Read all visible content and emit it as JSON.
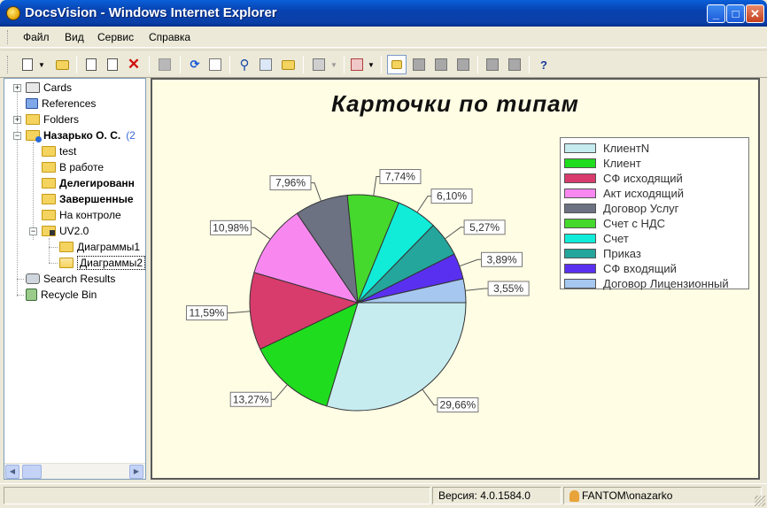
{
  "window": {
    "title": "DocsVision - Windows Internet Explorer",
    "min_label": "_",
    "max_label": "□",
    "close_label": "✕"
  },
  "menu": [
    "Файл",
    "Вид",
    "Сервис",
    "Справка"
  ],
  "tree": {
    "items": [
      {
        "label": "Cards",
        "icon": "cards-icon"
      },
      {
        "label": "References",
        "icon": "book-icon"
      },
      {
        "label": "Folders",
        "icon": "folder-icon"
      },
      {
        "label": "Назарько О. С.",
        "badge": "(2"
      },
      {
        "label": "test"
      },
      {
        "label": "В работе"
      },
      {
        "label": "Делегированн"
      },
      {
        "label": "Завершенные"
      },
      {
        "label": "На контроле"
      },
      {
        "label": "UV2.0"
      },
      {
        "label": "Диаграммы1"
      },
      {
        "label": "Диаграммы2"
      },
      {
        "label": "Search Results"
      },
      {
        "label": "Recycle Bin"
      }
    ]
  },
  "status": {
    "version": "Версия: 4.0.1584.0",
    "user": "FANTOM\\onazarko"
  },
  "chart_data": {
    "type": "pie",
    "title": "Карточки по типам",
    "legend_position": "top-right",
    "slices": [
      {
        "name": "КлиентN",
        "value": 29.66,
        "label": "29,66%",
        "color": "#c6ecf0"
      },
      {
        "name": "Клиент",
        "value": 13.27,
        "label": "13,27%",
        "color": "#1fdc1f"
      },
      {
        "name": "СФ исходящий",
        "value": 11.59,
        "label": "11,59%",
        "color": "#d83c6c"
      },
      {
        "name": "Акт исходящий",
        "value": 10.98,
        "label": "10,98%",
        "color": "#f888f0"
      },
      {
        "name": "Договор Услуг",
        "value": 7.96,
        "label": "7,96%",
        "color": "#6c7282"
      },
      {
        "name": "Счет с НДС",
        "value": 7.74,
        "label": "7,74%",
        "color": "#45d82d"
      },
      {
        "name": "Счет",
        "value": 6.1,
        "label": "6,10%",
        "color": "#10ecd8"
      },
      {
        "name": "Приказ",
        "value": 5.27,
        "label": "5,27%",
        "color": "#24a69c"
      },
      {
        "name": "СФ входящий",
        "value": 3.89,
        "label": "3,89%",
        "color": "#5a30f0"
      },
      {
        "name": "Договор Лицензионный",
        "value": 3.55,
        "label": "3,55%",
        "color": "#a6c8f0"
      }
    ]
  }
}
